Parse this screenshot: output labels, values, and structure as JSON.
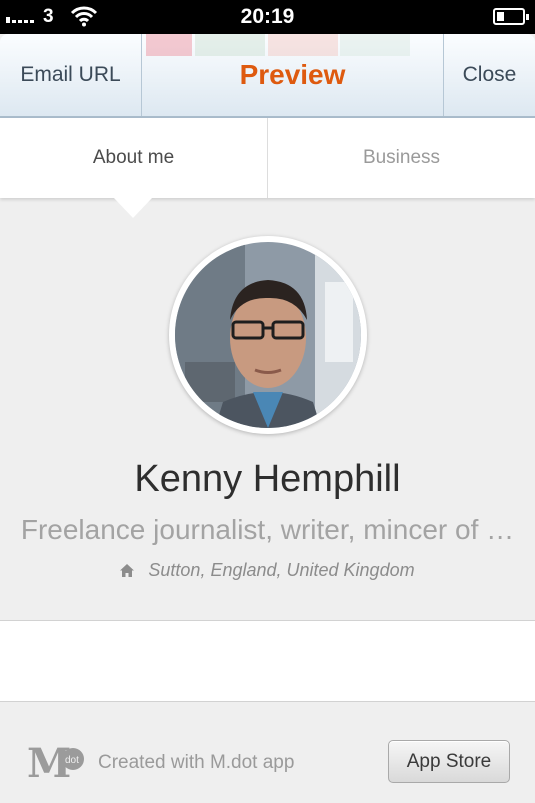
{
  "status_bar": {
    "carrier": "3",
    "time": "20:19",
    "battery_level": 0.3
  },
  "navbar": {
    "left_button": "Email URL",
    "title": "Preview",
    "right_button": "Close",
    "title_color": "#de5a0f"
  },
  "tabs": {
    "items": [
      "About me",
      "Business"
    ],
    "active": "About me"
  },
  "profile": {
    "name": "Kenny Hemphill",
    "tagline": "Freelance journalist, writer, mincer of …",
    "location": "Sutton, England, United Kingdom"
  },
  "footer": {
    "logo": "M.dot",
    "created_with": "Created with M.dot app",
    "app_store_button": "App Store"
  },
  "icons": [
    "cellular-signal-icon",
    "wifi-icon",
    "battery-icon",
    "home-icon",
    "mdot-logo"
  ]
}
